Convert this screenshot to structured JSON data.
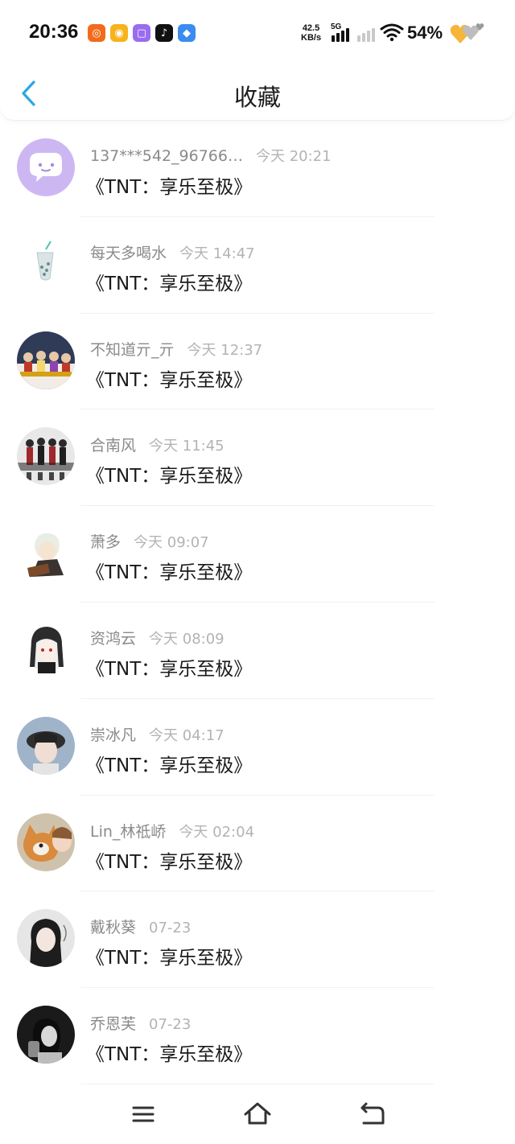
{
  "status_bar": {
    "time": "20:36",
    "net_speed_value": "42.5",
    "net_speed_unit": "KB/s",
    "network_type": "5G",
    "battery": "54%",
    "app_icons": [
      {
        "name": "app-icon-1",
        "color": "#f26a1b",
        "glyph": "◎"
      },
      {
        "name": "weibo-icon",
        "color": "#f7b21c",
        "glyph": "◉"
      },
      {
        "name": "app-icon-3",
        "color": "#9a6cf0",
        "glyph": "▢"
      },
      {
        "name": "tiktok-icon",
        "color": "#111111",
        "glyph": "♪"
      },
      {
        "name": "app-icon-5",
        "color": "#3b8cf0",
        "glyph": "◆"
      }
    ]
  },
  "header": {
    "title": "收藏"
  },
  "favorites": [
    {
      "user": "137***542_96766…",
      "time": "今天 20:21",
      "content": "《TNT：享乐至极》"
    },
    {
      "user": "每天多喝水",
      "time": "今天 14:47",
      "content": "《TNT：享乐至极》"
    },
    {
      "user": "不知道亓_亓",
      "time": "今天 12:37",
      "content": "《TNT：享乐至极》"
    },
    {
      "user": "合南风",
      "time": "今天 11:45",
      "content": "《TNT：享乐至极》"
    },
    {
      "user": "萧多",
      "time": "今天 09:07",
      "content": "《TNT：享乐至极》"
    },
    {
      "user": "资鸿云",
      "time": "今天 08:09",
      "content": "《TNT：享乐至极》"
    },
    {
      "user": "崇冰凡",
      "time": "今天 04:17",
      "content": "《TNT：享乐至极》"
    },
    {
      "user": "Lin_林祗峤",
      "time": "今天 02:04",
      "content": "《TNT：享乐至极》"
    },
    {
      "user": "戴秋葵",
      "time": "07-23",
      "content": "《TNT：享乐至极》"
    },
    {
      "user": "乔恩芙",
      "time": "07-23",
      "content": "《TNT：享乐至极》"
    }
  ],
  "colors": {
    "accent": "#2aa8e0",
    "meta_text": "#8a8a8a",
    "time_text": "#b3b3b3"
  }
}
